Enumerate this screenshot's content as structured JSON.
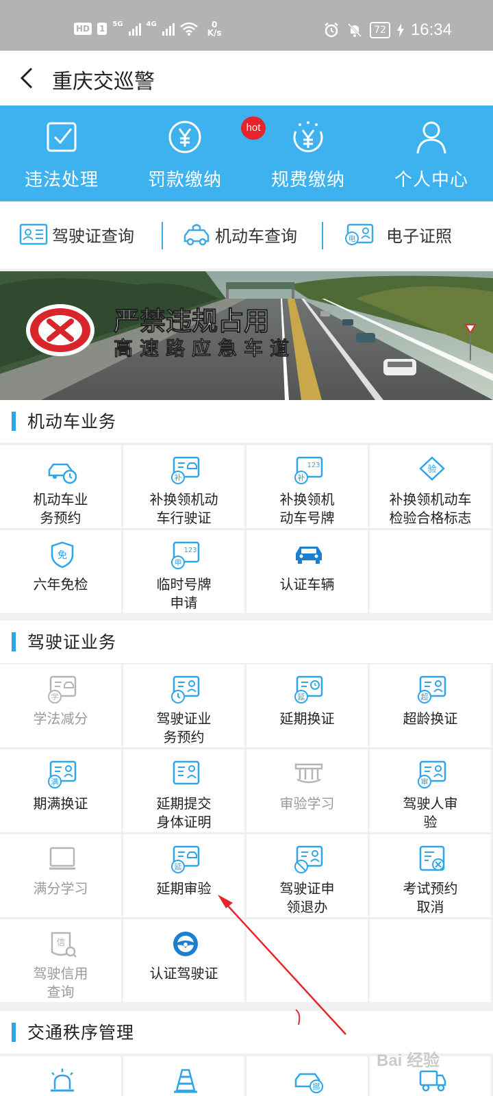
{
  "status_bar": {
    "hd": "HD",
    "sim": "1",
    "net1": "5G",
    "net2": "4G",
    "speed_value": "0",
    "speed_unit": "K/s",
    "battery": "72",
    "time": "16:34"
  },
  "header": {
    "title": "重庆交巡警"
  },
  "top_nav": [
    {
      "label": "违法处理",
      "icon": "checkbox-icon"
    },
    {
      "label": "罚款缴纳",
      "icon": "yen-coin-icon"
    },
    {
      "label": "规费缴纳",
      "icon": "yen-fee-icon"
    },
    {
      "label": "个人中心",
      "icon": "person-icon"
    }
  ],
  "hot_badge": "hot",
  "quick_links": [
    {
      "label": "驾驶证查询",
      "icon": "license-card-icon"
    },
    {
      "label": "机动车查询",
      "icon": "car-lock-icon"
    },
    {
      "label": "电子证照",
      "icon": "e-license-icon"
    }
  ],
  "banner": {
    "line1": "严禁违规占用",
    "line2": "高速路应急车道"
  },
  "sections": {
    "vehicle": {
      "title": "机动车业务",
      "items": [
        {
          "label1": "机动车业",
          "label2": "务预约",
          "icon": "car-clock-icon"
        },
        {
          "label1": "补换领机动",
          "label2": "车行驶证",
          "icon": "replace-car-license-icon"
        },
        {
          "label1": "补换领机",
          "label2": "动车号牌",
          "icon": "replace-plate-icon"
        },
        {
          "label1": "补换领机动车",
          "label2": "检验合格标志",
          "icon": "inspection-badge-icon"
        },
        {
          "label1": "六年免检",
          "label2": "",
          "icon": "exempt-shield-icon"
        },
        {
          "label1": "临时号牌",
          "label2": "申请",
          "icon": "temp-plate-icon"
        },
        {
          "label1": "认证车辆",
          "label2": "",
          "icon": "car-icon"
        }
      ]
    },
    "license": {
      "title": "驾驶证业务",
      "items": [
        {
          "label1": "学法减分",
          "label2": "",
          "icon": "study-deduct-icon",
          "gray": true
        },
        {
          "label1": "驾驶证业",
          "label2": "务预约",
          "icon": "license-clock-icon"
        },
        {
          "label1": "延期换证",
          "label2": "",
          "icon": "extend-renew-icon"
        },
        {
          "label1": "超龄换证",
          "label2": "",
          "icon": "overage-renew-icon"
        },
        {
          "label1": "期满换证",
          "label2": "",
          "icon": "expiry-renew-icon"
        },
        {
          "label1": "延期提交",
          "label2": "身体证明",
          "icon": "health-proof-icon"
        },
        {
          "label1": "审验学习",
          "label2": "",
          "icon": "review-study-icon",
          "gray": true
        },
        {
          "label1": "驾驶人审",
          "label2": "验",
          "icon": "driver-review-icon"
        },
        {
          "label1": "满分学习",
          "label2": "",
          "icon": "book-icon",
          "gray": true
        },
        {
          "label1": "延期审验",
          "label2": "",
          "icon": "extend-review-icon"
        },
        {
          "label1": "驾驶证申",
          "label2": "领退办",
          "icon": "license-cancel-icon"
        },
        {
          "label1": "考试预约",
          "label2": "取消",
          "icon": "exam-cancel-icon"
        },
        {
          "label1": "驾驶信用",
          "label2": "查询",
          "icon": "credit-query-icon",
          "gray": true
        },
        {
          "label1": "认证驾驶证",
          "label2": "",
          "icon": "steering-wheel-icon"
        }
      ]
    },
    "traffic": {
      "title": "交通秩序管理"
    }
  },
  "watermark": "Bai 经验",
  "colors": {
    "primary": "#3eb2ee",
    "accent": "#2ea4ea",
    "hot": "#e8232a",
    "annotation_arrow": "#e8232a"
  }
}
